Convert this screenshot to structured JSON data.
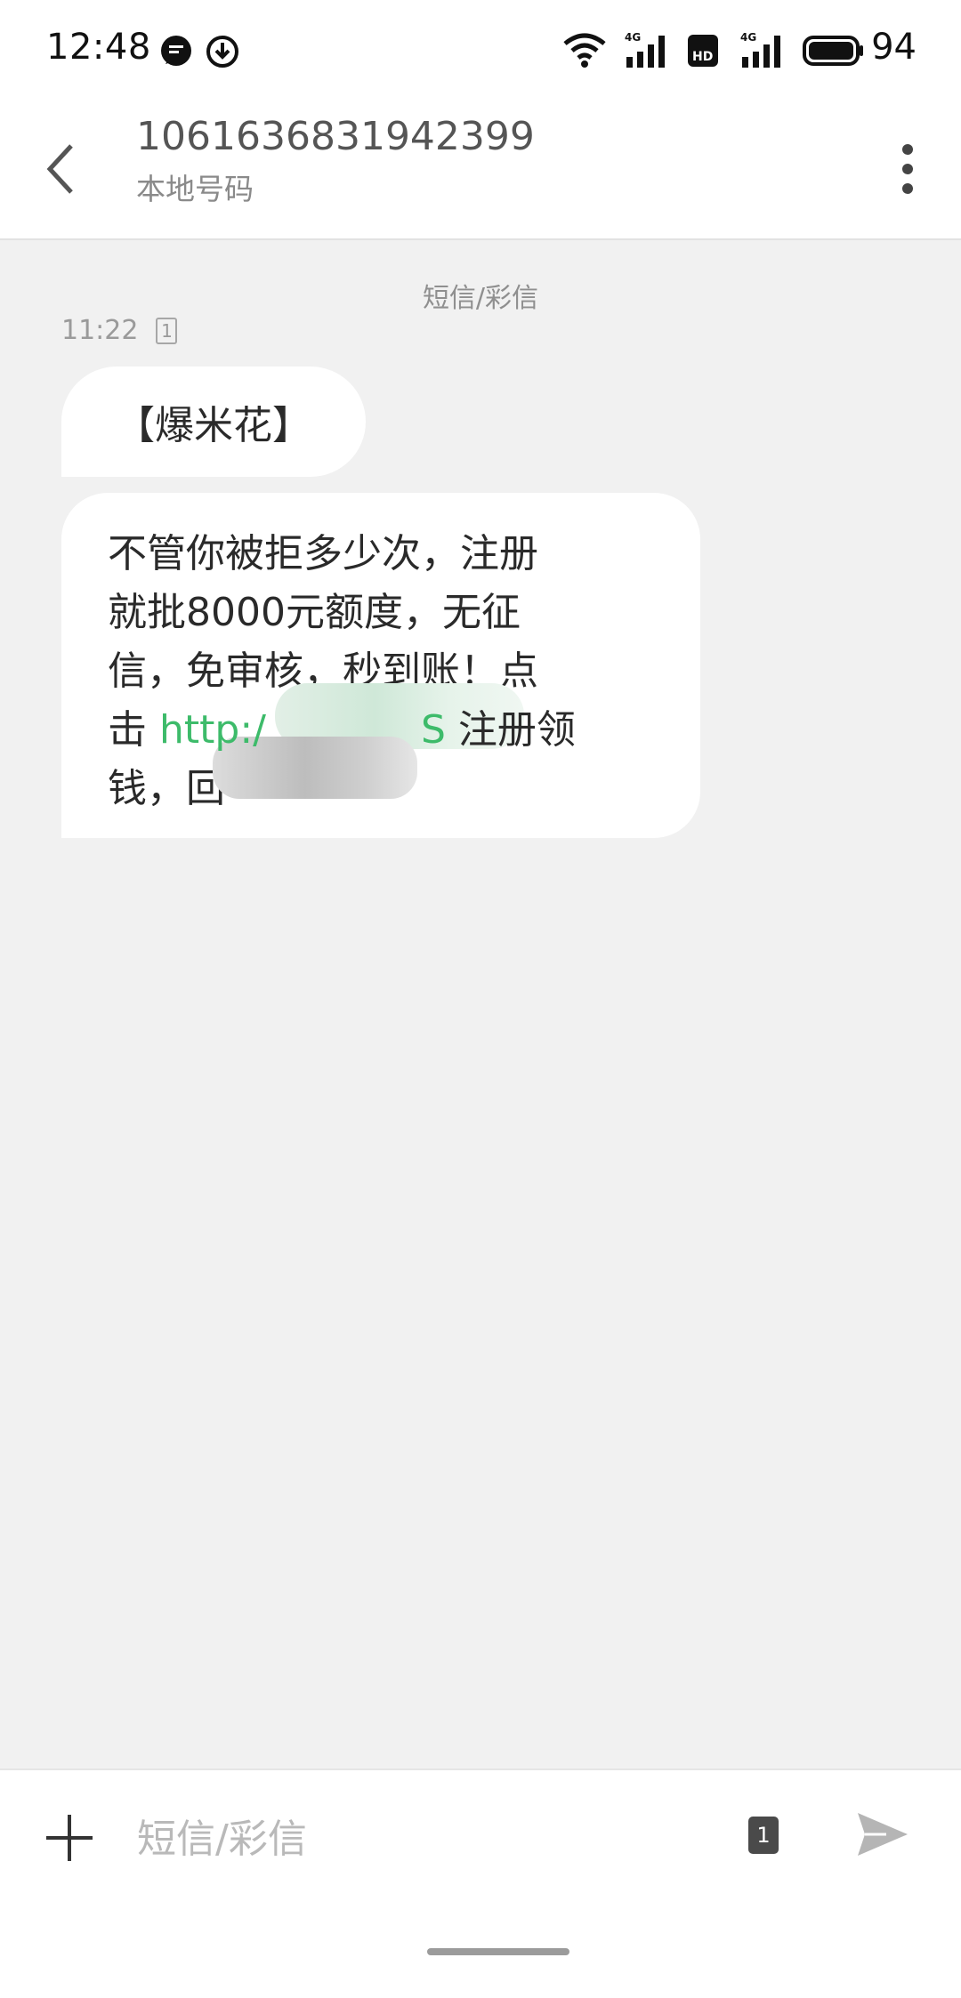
{
  "status_bar": {
    "time": "12:48",
    "battery_level": "94",
    "icons": [
      "message-icon",
      "download-icon",
      "wifi-icon",
      "signal-4g-icon",
      "hd-icon",
      "signal-4g-icon",
      "battery-icon"
    ]
  },
  "header": {
    "title": "1061636831942399",
    "subtitle": "本地号码"
  },
  "conversation": {
    "channel_label": "短信/彩信",
    "time": "11:22",
    "sim_slot": "1",
    "messages": [
      {
        "text": "【爆米花】"
      },
      {
        "line1": "不管你被拒多少次，注册",
        "line2": "就批8000元额度，无征",
        "line3": "信，免审核，秒到账！点",
        "line4_prefix": "击 ",
        "link_start": "http:/",
        "link_end": "S",
        "line4_suffix": " 注册领",
        "line5_prefix": "钱，回"
      }
    ]
  },
  "composer": {
    "placeholder": "短信/彩信",
    "sim_slot": "1"
  }
}
